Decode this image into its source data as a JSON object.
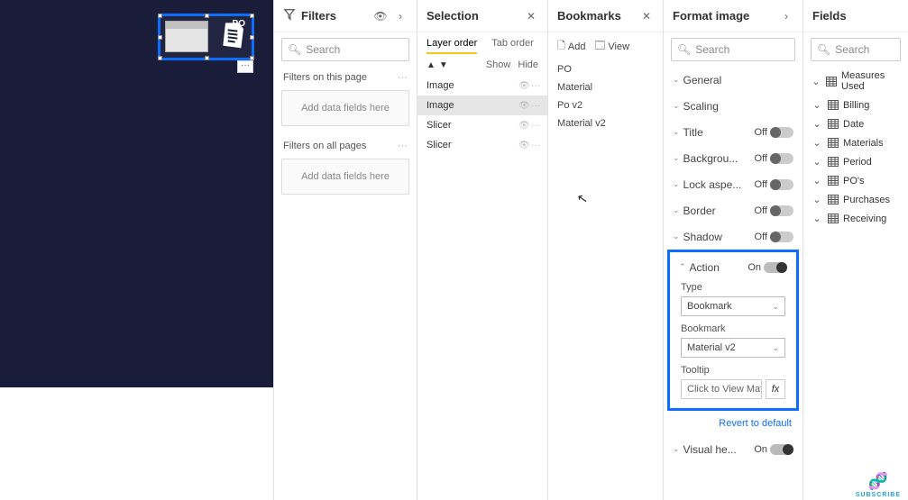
{
  "canvas_visual": {
    "po_label": "PO"
  },
  "filters": {
    "title": "Filters",
    "search_placeholder": "Search",
    "page_label": "Filters on this page",
    "all_label": "Filters on all pages",
    "drop_hint": "Add data fields here"
  },
  "selection": {
    "title": "Selection",
    "tab_layer": "Layer order",
    "tab_tab": "Tab order",
    "show": "Show",
    "hide": "Hide",
    "items": [
      {
        "label": "Image",
        "selected": false
      },
      {
        "label": "Image",
        "selected": true
      },
      {
        "label": "Slicer",
        "selected": false
      },
      {
        "label": "Slicer",
        "selected": false
      }
    ]
  },
  "bookmarks": {
    "title": "Bookmarks",
    "add": "Add",
    "view": "View",
    "items": [
      "PO",
      "Material",
      "Po v2",
      "Material v2"
    ]
  },
  "format": {
    "title": "Format image",
    "search_placeholder": "Search",
    "rows": {
      "general": "General",
      "scaling": "Scaling",
      "title": "Title",
      "background": "Backgrou...",
      "lock": "Lock aspe...",
      "border": "Border",
      "shadow": "Shadow",
      "action": "Action",
      "visual_header": "Visual he..."
    },
    "states": {
      "title": "Off",
      "background": "Off",
      "lock": "Off",
      "border": "Off",
      "shadow": "Off",
      "action": "On",
      "visual_header": "On"
    },
    "sub": {
      "type_label": "Type",
      "type_value": "Bookmark",
      "bookmark_label": "Bookmark",
      "bookmark_value": "Material v2",
      "tooltip_label": "Tooltip",
      "tooltip_value": "Click to View Mate...",
      "fx": "fx"
    },
    "revert": "Revert to default"
  },
  "fields": {
    "title": "Fields",
    "search_placeholder": "Search",
    "items": [
      "Measures Used",
      "Billing",
      "Date",
      "Materials",
      "Period",
      "PO's",
      "Purchases",
      "Receiving"
    ]
  },
  "subscribe": "SUBSCRIBE"
}
